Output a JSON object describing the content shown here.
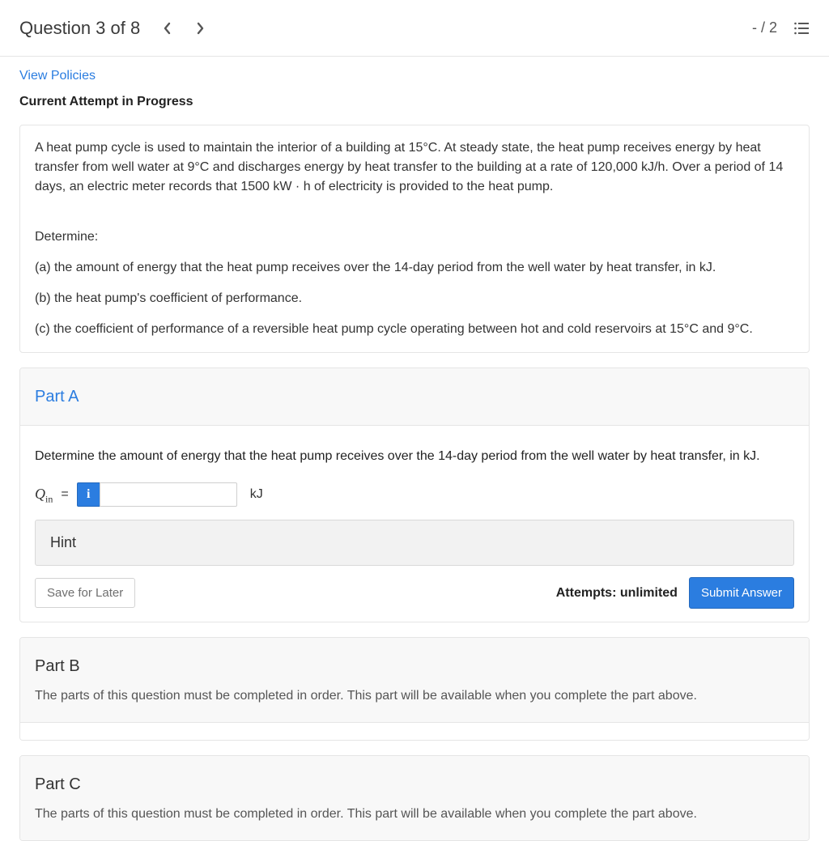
{
  "header": {
    "title": "Question 3 of 8",
    "score": "- / 2"
  },
  "links": {
    "view_policies": "View Policies"
  },
  "attempt_status": "Current Attempt in Progress",
  "problem": {
    "intro": "A heat pump cycle is used to maintain the interior of a building at 15°C. At steady state, the heat pump receives energy by heat transfer from well water at 9°C and discharges energy by heat transfer to the building at a rate of 120,000 kJ/h. Over a period of 14 days, an electric meter records that 1500 kW · h of electricity is provided to the heat pump.",
    "determine": "Determine:",
    "a": "(a) the amount of energy that the heat pump receives over the 14-day period from the well water by heat transfer, in kJ.",
    "b": "(b) the heat pump's coefficient of performance.",
    "c": "(c) the coefficient of performance of a reversible heat pump cycle operating between hot and cold reservoirs at 15°C and 9°C."
  },
  "partA": {
    "title": "Part A",
    "prompt": "Determine the amount of energy that the heat pump receives over the 14-day period from the well water by heat transfer, in kJ.",
    "varname": "Q",
    "varsub": "in",
    "equals": "=",
    "info": "i",
    "unit": "kJ",
    "hint_label": "Hint",
    "save_label": "Save for Later",
    "attempts_label": "Attempts: unlimited",
    "submit_label": "Submit Answer"
  },
  "partB": {
    "title": "Part B",
    "locked_msg": "The parts of this question must be completed in order. This part will be available when you complete the part above."
  },
  "partC": {
    "title": "Part C",
    "locked_msg": "The parts of this question must be completed in order. This part will be available when you complete the part above."
  }
}
